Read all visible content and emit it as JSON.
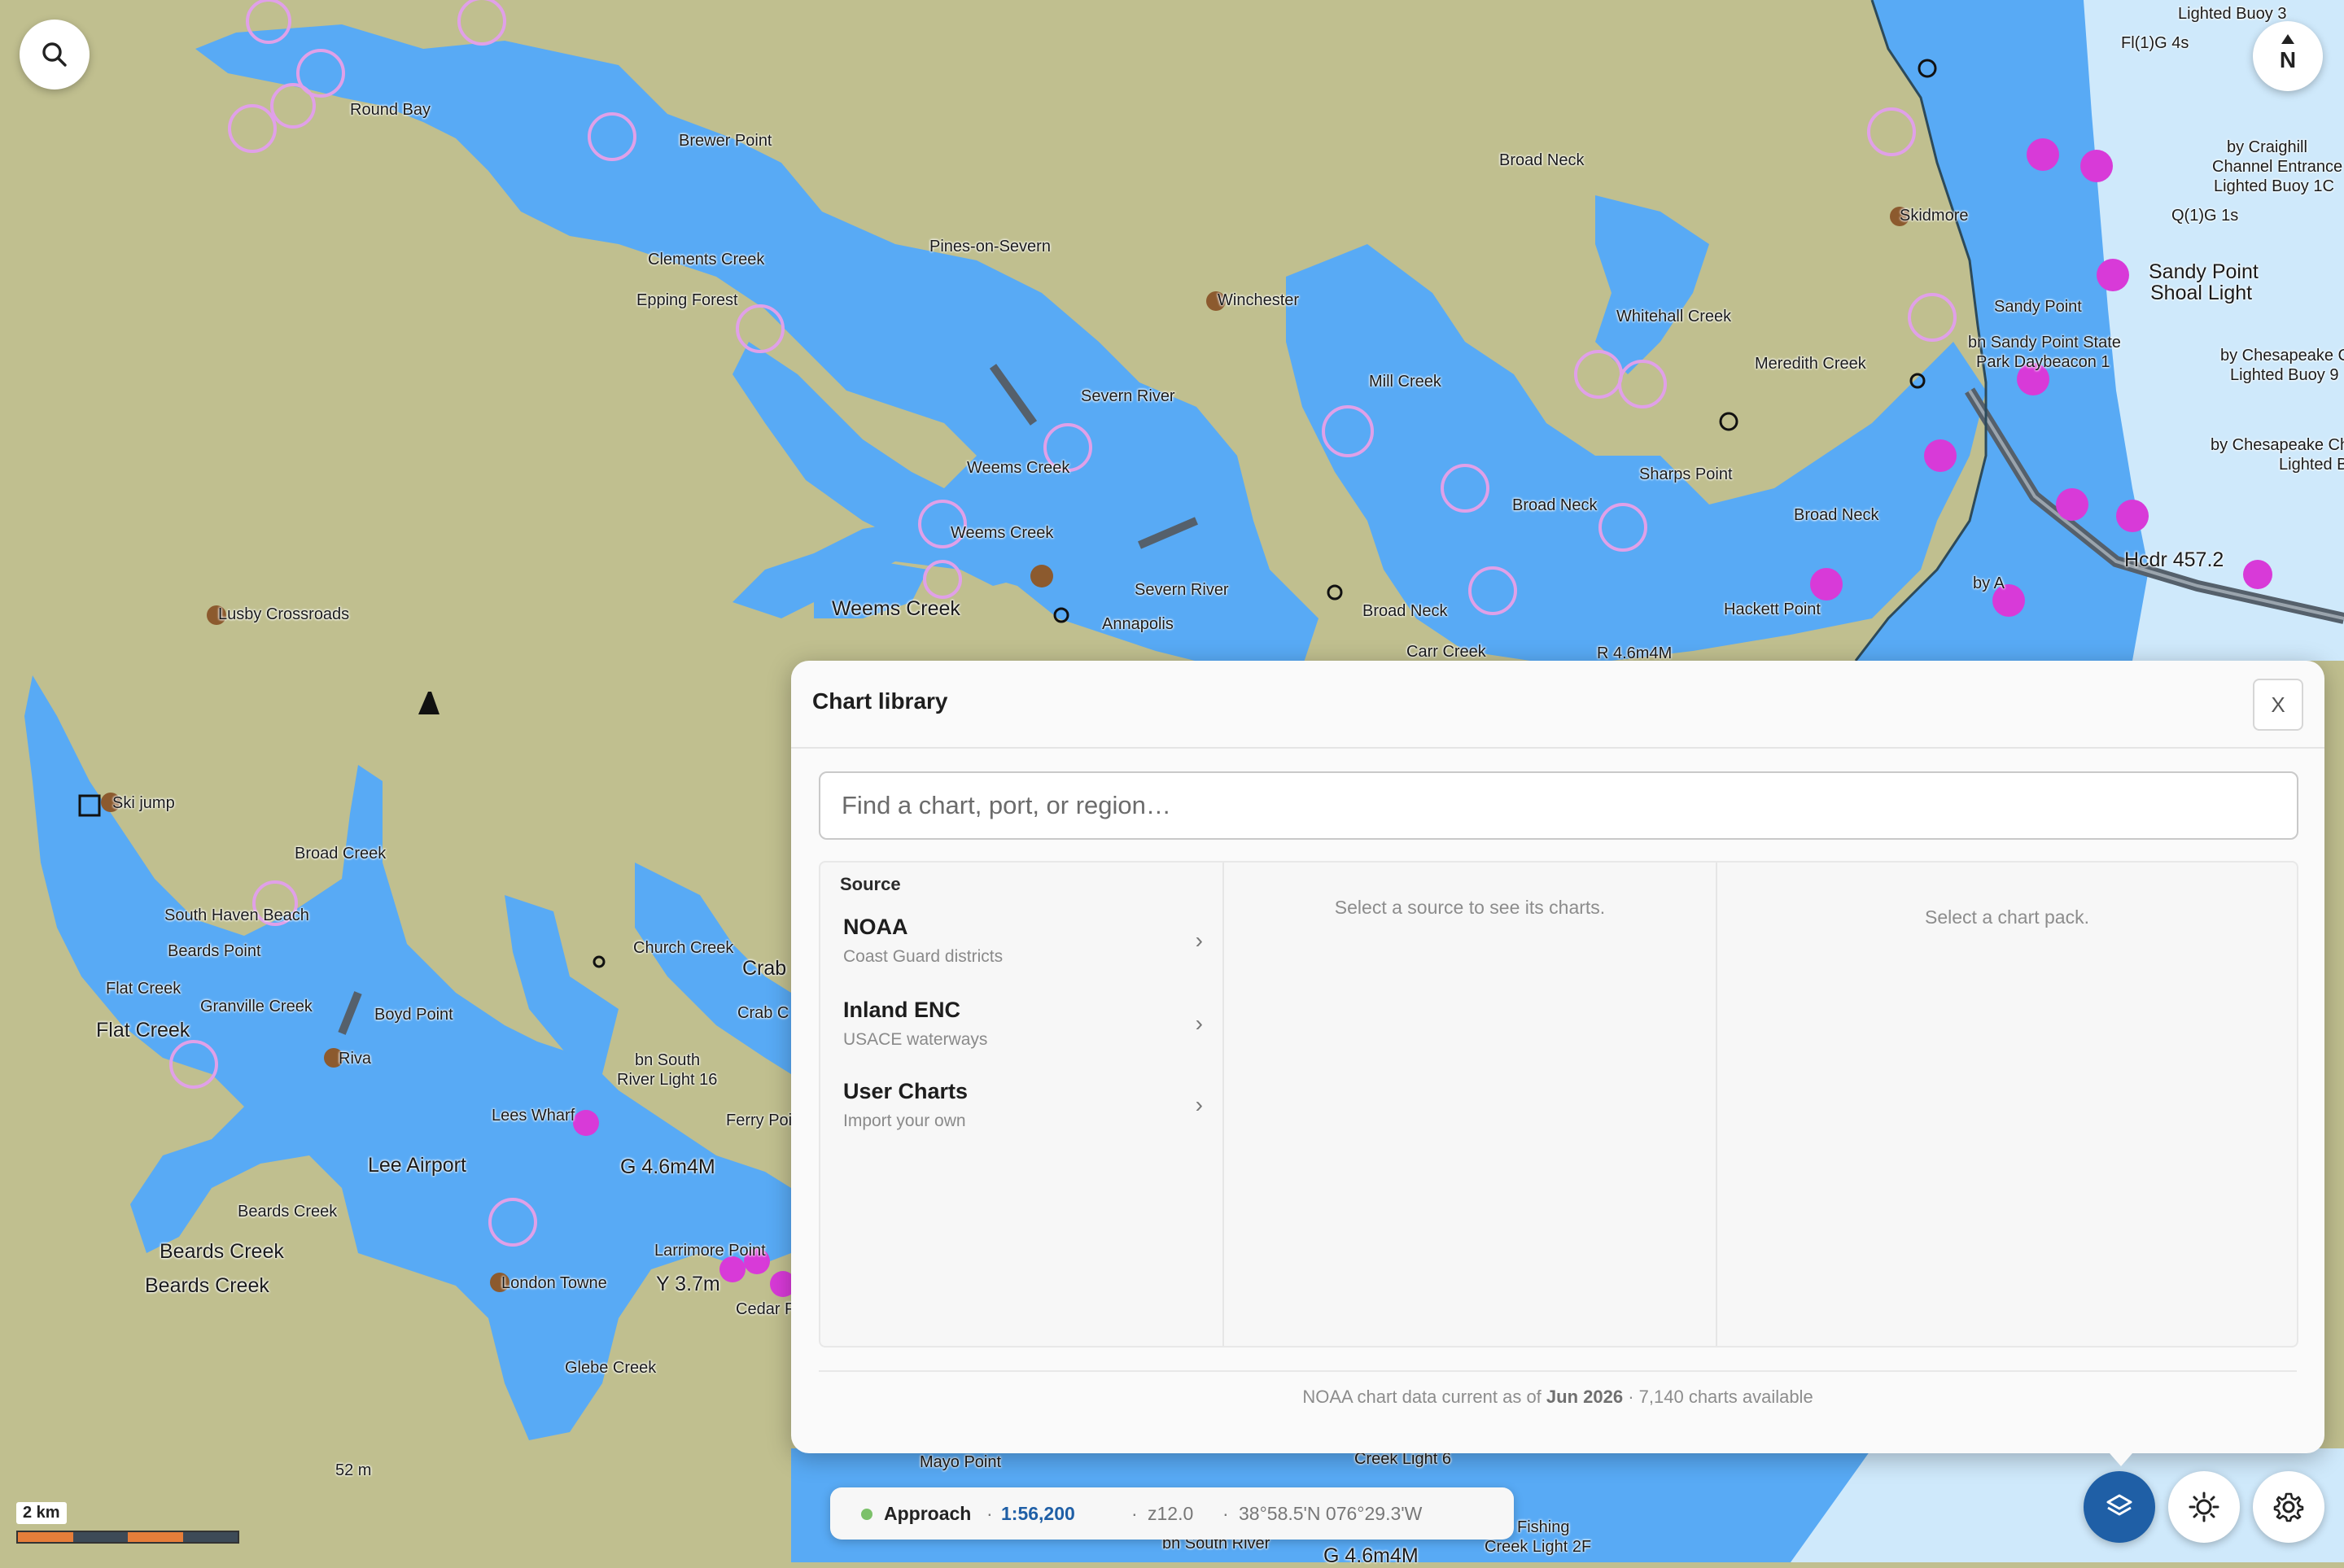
{
  "map": {
    "labels": [
      {
        "text": "Round Bay"
      },
      {
        "text": "Brewer Point"
      },
      {
        "text": "Clements Creek"
      },
      {
        "text": "Epping Forest"
      },
      {
        "text": "Pines-on-Severn"
      },
      {
        "text": "Winchester"
      },
      {
        "text": "Severn River"
      },
      {
        "text": "Weems Creek"
      },
      {
        "text": "Weems Creek"
      },
      {
        "text": "Weems Creek"
      },
      {
        "text": "Severn River"
      },
      {
        "text": "Annapolis"
      },
      {
        "text": "Lusby Crossroads"
      },
      {
        "text": "Broad Neck"
      },
      {
        "text": "Skidmore"
      },
      {
        "text": "Whitehall Creek"
      },
      {
        "text": "Mill Creek"
      },
      {
        "text": "Meredith Creek"
      },
      {
        "text": "Sharps Point"
      },
      {
        "text": "Broad Neck"
      },
      {
        "text": "Broad Neck"
      },
      {
        "text": "Hackett Point"
      },
      {
        "text": "Broad Neck"
      },
      {
        "text": "Carr Creek"
      },
      {
        "text": "Sandy Point"
      },
      {
        "text": "bn Sandy Point State"
      },
      {
        "text": "Park Daybeacon 1"
      },
      {
        "text": "Sandy Point"
      },
      {
        "text": "Shoal Light"
      },
      {
        "text": "Fl(1)G 4s"
      },
      {
        "text": "Lighted Buoy 3"
      },
      {
        "text": "by Craighill"
      },
      {
        "text": "Channel Entrance"
      },
      {
        "text": "Lighted Buoy 1C"
      },
      {
        "text": "Q(1)G 1s"
      },
      {
        "text": "by Chesapeake Cha"
      },
      {
        "text": "Lighted Buoy 9"
      },
      {
        "text": "by Chesapeake Ch"
      },
      {
        "text": "Lighted Buoy"
      },
      {
        "text": "Hcdr 457.2"
      },
      {
        "text": "by A"
      },
      {
        "text": "R 4.6m4M"
      },
      {
        "text": "Ski jump"
      },
      {
        "text": "Broad Creek"
      },
      {
        "text": "South Haven Beach"
      },
      {
        "text": "Beards Point"
      },
      {
        "text": "Flat Creek"
      },
      {
        "text": "Flat Creek"
      },
      {
        "text": "Granville Creek"
      },
      {
        "text": "Boyd Point"
      },
      {
        "text": "Riva"
      },
      {
        "text": "Lees Wharf"
      },
      {
        "text": "Lee Airport"
      },
      {
        "text": "Beards Creek"
      },
      {
        "text": "Beards Creek"
      },
      {
        "text": "Beards Creek"
      },
      {
        "text": "London Towne"
      },
      {
        "text": "Church Creek"
      },
      {
        "text": "bn South"
      },
      {
        "text": "River Light 16"
      },
      {
        "text": "G 4.6m4M"
      },
      {
        "text": "Larrimore Point"
      },
      {
        "text": "Y 3.7m"
      },
      {
        "text": "Glebe Creek"
      },
      {
        "text": "Crab"
      },
      {
        "text": "Crab C"
      },
      {
        "text": "Ferry Poi"
      },
      {
        "text": "Cedar P"
      },
      {
        "text": "Mayo Point"
      },
      {
        "text": "Creek Light 6"
      },
      {
        "text": "bn South River"
      },
      {
        "text": "Fishing"
      },
      {
        "text": "Creek Light 2F"
      },
      {
        "text": "G 4.6m4M"
      },
      {
        "text": "52 m"
      }
    ]
  },
  "controls": {
    "search_icon": "search-icon",
    "compass_label": "N",
    "layers_icon": "layers-icon",
    "brightness_icon": "sun-icon",
    "settings_icon": "gear-icon"
  },
  "scale_bar": {
    "label": "2 km"
  },
  "status_bar": {
    "mode": "Approach",
    "mode_color": "#7cc16a",
    "scale": "1:56,200",
    "zoom": "z12.0",
    "position": "38°58.5'N 076°29.3'W"
  },
  "panel": {
    "title": "Chart library",
    "close_label": "X",
    "search_placeholder": "Find a chart, port, or region…",
    "source_header": "Source",
    "sources": [
      {
        "name": "NOAA",
        "subtitle": "Coast Guard districts"
      },
      {
        "name": "Inland ENC",
        "subtitle": "USACE waterways"
      },
      {
        "name": "User Charts",
        "subtitle": "Import your own"
      }
    ],
    "charts_empty": "Select a source to see its charts.",
    "packs_empty": "Select a chart pack.",
    "footer_prefix": "NOAA chart data current as of",
    "footer_date": "Jun 2026",
    "footer_suffix": "· 7,140 charts available"
  },
  "colors": {
    "land": "#c0bf8f",
    "water": "#58aaf5",
    "deep_water": "#cfe9fb",
    "accent": "#1f5fa6",
    "magenta": "#d83ad8"
  }
}
